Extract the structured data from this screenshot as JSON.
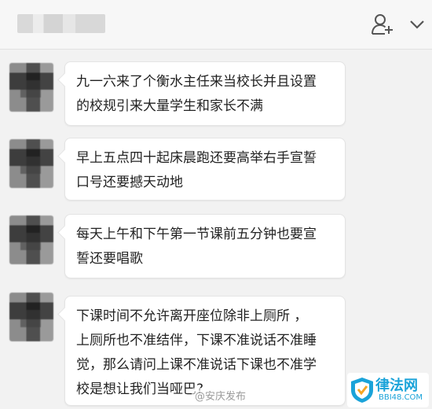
{
  "header": {
    "chat_title": "",
    "add_member_icon": "add-user-icon",
    "menu_icon": "chevron-down-icon"
  },
  "messages": [
    {
      "lines": [
        "九一六来了个衡水主任来当校长并且设置",
        "的校规引来大量学生和家长不满"
      ]
    },
    {
      "lines": [
        "早上五点四十起床晨跑还要高举右手宣誓",
        "口号还要撼天动地"
      ]
    },
    {
      "lines": [
        "每天上午和下午第一节课前五分钟也要宣",
        "誓还要唱歌"
      ]
    },
    {
      "lines": [
        "下课时间不允许离开座位除非上厕所  ，",
        "上厕所也不准结伴，下课不准说话不准睡",
        "觉，那么请问上课不准说话下课也不准学",
        "校是想让我们当哑巴?"
      ]
    }
  ],
  "watermarks": {
    "weibo": "@安庆发布",
    "logo_name": "律法网",
    "logo_domain": "BBI48.COM"
  },
  "colors": {
    "background": "#f2f2f2",
    "bubble": "#ffffff",
    "text": "#222222",
    "logo_blue": "#1aa3d9"
  }
}
